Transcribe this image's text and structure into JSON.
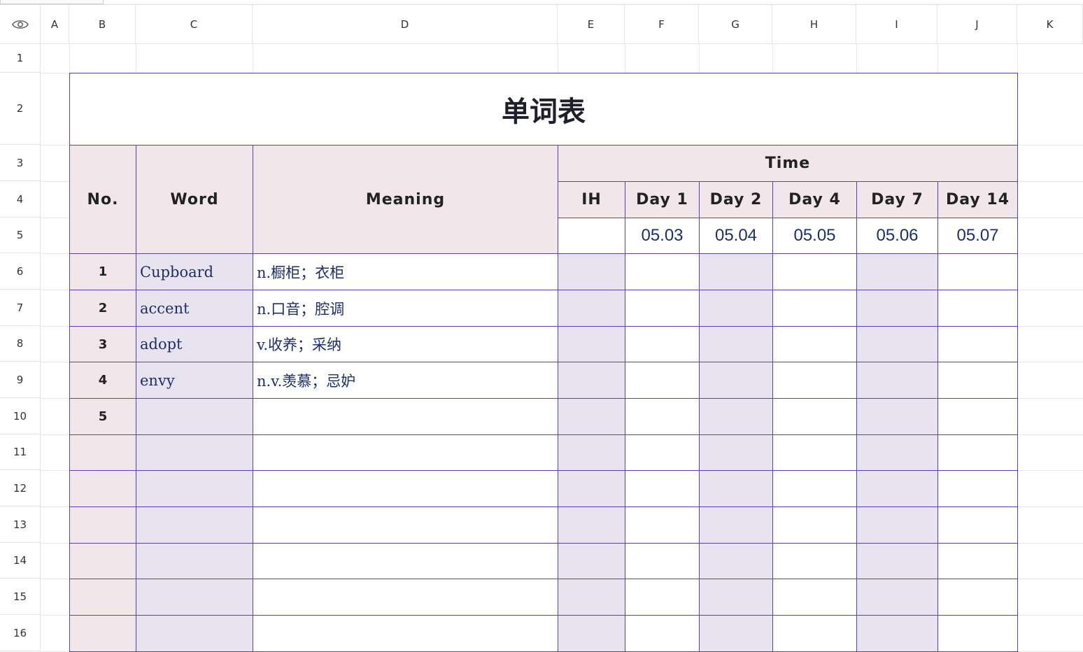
{
  "sheet": {
    "columns": [
      "A",
      "B",
      "C",
      "D",
      "E",
      "F",
      "G",
      "H",
      "I",
      "J",
      "K"
    ],
    "rows": [
      "1",
      "2",
      "3",
      "4",
      "5",
      "6",
      "7",
      "8",
      "9",
      "10",
      "11",
      "12",
      "13",
      "14",
      "15",
      "16"
    ],
    "eye_icon": "eye-icon"
  },
  "table": {
    "title": "单词表",
    "headers": {
      "no": "No.",
      "word": "Word",
      "meaning": "Meaning",
      "time": "Time",
      "ih": "IH",
      "day1": "Day 1",
      "day2": "Day 2",
      "day4": "Day 4",
      "day7": "Day 7",
      "day14": "Day 14"
    },
    "dates": [
      "05.03",
      "05.04",
      "05.05",
      "05.06",
      "05.07"
    ],
    "entries": [
      {
        "no": "1",
        "word": "Cupboard",
        "meaning": "n.橱柜；衣柜"
      },
      {
        "no": "2",
        "word": "accent",
        "meaning": "n.口音；腔调"
      },
      {
        "no": "3",
        "word": "adopt",
        "meaning": "v.收养；采纳"
      },
      {
        "no": "4",
        "word": "envy",
        "meaning": "n.v.羡慕；忌妒"
      },
      {
        "no": "5",
        "word": "",
        "meaning": ""
      },
      {
        "no": "",
        "word": "",
        "meaning": ""
      },
      {
        "no": "",
        "word": "",
        "meaning": ""
      },
      {
        "no": "",
        "word": "",
        "meaning": ""
      },
      {
        "no": "",
        "word": "",
        "meaning": ""
      },
      {
        "no": "",
        "word": "",
        "meaning": ""
      },
      {
        "no": "",
        "word": "",
        "meaning": ""
      }
    ]
  },
  "colors": {
    "border": "#5a3fbf",
    "header_bg": "#f1e6ea",
    "shade_bg": "#e8e4ef",
    "text_blue": "#1e2e6b"
  }
}
